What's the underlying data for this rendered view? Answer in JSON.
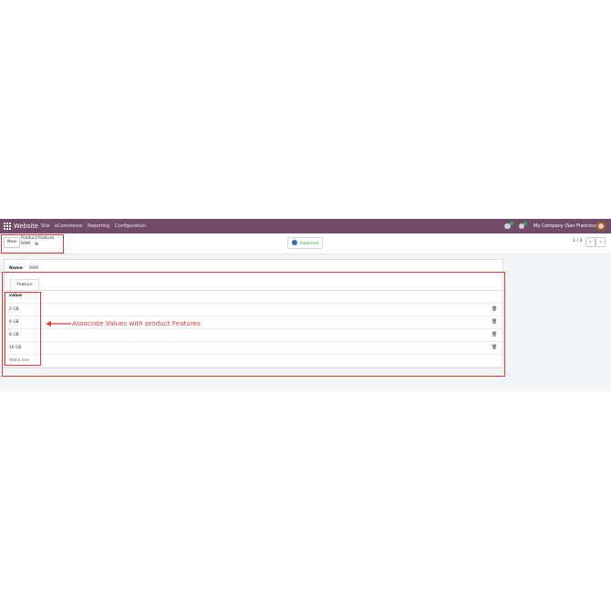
{
  "navbar": {
    "app_name": "Website",
    "menu": [
      "Site",
      "eCommerce",
      "Reporting",
      "Configuration"
    ],
    "company": "My Company (San Francisco)",
    "chat_badge": "",
    "activity_badge": ""
  },
  "controlbar": {
    "new_label": "New",
    "breadcrumb_parent": "Product Feature",
    "breadcrumb_current": "RAM",
    "published_label": "Published",
    "pager": "1 / 3"
  },
  "form": {
    "name_label": "Name",
    "name_value": "RAM",
    "tab_label": "Feature",
    "column_header": "value",
    "rows": [
      "2 GB",
      "4 GB",
      "8 GB",
      "16 GB"
    ],
    "add_line": "Add a line"
  },
  "annotation": {
    "text": "Associate Values with product Features",
    "color": "#e53935"
  },
  "colors": {
    "navbar": "#714b67",
    "background": "#f3f4f6",
    "published": "#28a745"
  },
  "icons": [
    "apps-grid-icon",
    "chat-icon",
    "activity-icon",
    "gear-icon",
    "globe-icon",
    "chevron-left-icon",
    "chevron-right-icon",
    "trash-icon"
  ]
}
